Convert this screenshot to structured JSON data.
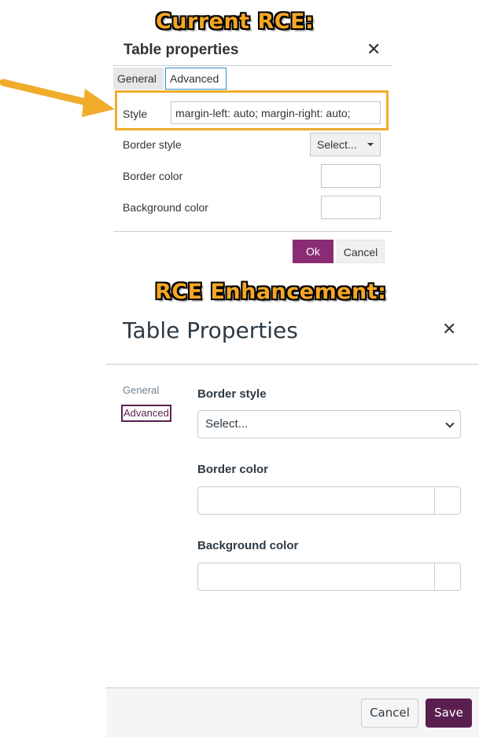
{
  "old_dialog": {
    "heading": "Current RCE:",
    "title": "Table properties",
    "close": "✕",
    "tabs": {
      "general": "General",
      "advanced": "Advanced"
    },
    "style_label": "Style",
    "style_value": "margin-left: auto; margin-right: auto;",
    "border_style_label": "Border style",
    "border_style_value": "Select...",
    "border_color_label": "Border color",
    "background_color_label": "Background color",
    "ok_label": "Ok",
    "cancel_label": "Cancel",
    "colors": {
      "ok": "#8a2c73",
      "highlight": "#f0ac2a",
      "arrow": "#f0ac2a"
    }
  },
  "new_dialog": {
    "heading": "RCE Enhancement:",
    "title": "Table Properties",
    "close": "✕",
    "tabs": {
      "general": "General",
      "advanced": "Advanced"
    },
    "border_style_label": "Border style",
    "border_style_value": "Select...",
    "border_color_label": "Border color",
    "background_color_label": "Background color",
    "cancel_label": "Cancel",
    "save_label": "Save",
    "colors": {
      "save": "#5a1f4f",
      "text": "#2d3b45"
    }
  }
}
